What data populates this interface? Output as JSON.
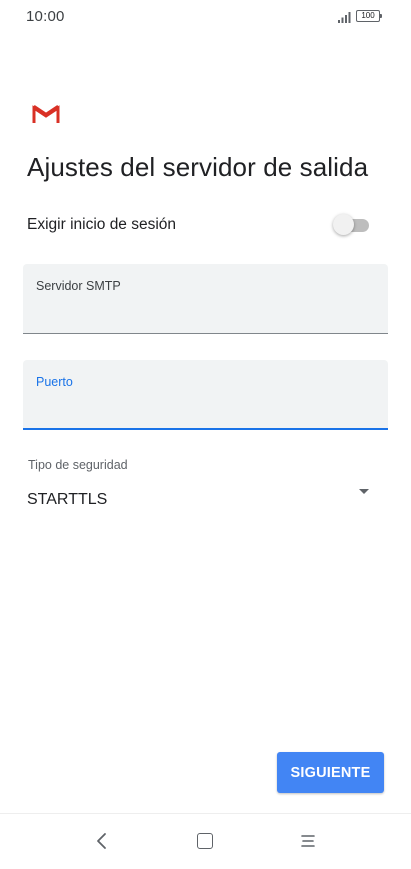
{
  "status_bar": {
    "time": "10:00",
    "battery": "100"
  },
  "icons": {
    "app_logo": "gmail-icon",
    "signal": "signal-icon",
    "battery": "battery-icon",
    "dropdown": "dropdown-arrow-icon",
    "nav_back": "back-icon",
    "nav_home": "home-icon",
    "nav_recents": "menu-icon"
  },
  "page": {
    "title": "Ajustes del servidor de salida"
  },
  "require_login": {
    "label": "Exigir inicio de sesión",
    "enabled": false
  },
  "smtp_server": {
    "label": "Servidor SMTP",
    "value": ""
  },
  "port": {
    "label": "Puerto",
    "value": ""
  },
  "security_type": {
    "label": "Tipo de seguridad",
    "value": "STARTTLS"
  },
  "actions": {
    "next_label": "SIGUIENTE"
  },
  "colors": {
    "accent": "#1a73e8",
    "button": "#4285f4",
    "gmail_red": "#d93025",
    "field_background": "#f1f3f4"
  }
}
